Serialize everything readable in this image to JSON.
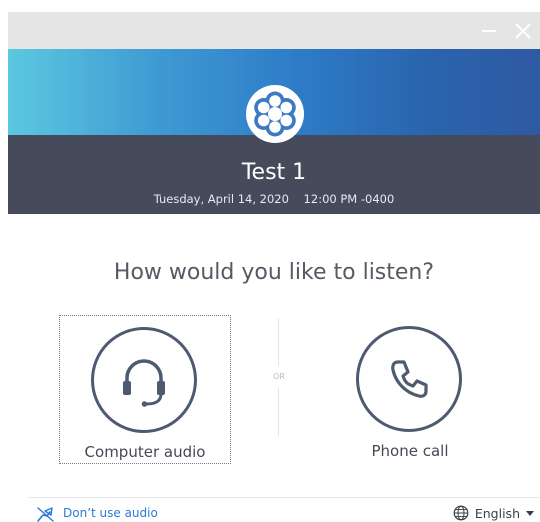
{
  "window": {
    "minimize_icon": "minimize-icon",
    "close_icon": "close-icon"
  },
  "header": {
    "logo_icon": "flower-logo-icon",
    "meeting_title": "Test 1",
    "meeting_datetime": "Tuesday, April 14, 2020    12:00 PM -0400",
    "gradient_colors": [
      "#5cc8df",
      "#2e5aa2"
    ],
    "band_color": "#454b5b"
  },
  "main": {
    "question": "How would you like to listen?",
    "options": [
      {
        "label": "Computer audio",
        "icon": "headset-icon",
        "selected": true
      },
      {
        "label": "Phone call",
        "icon": "phone-icon",
        "selected": false
      }
    ],
    "separator": "OR"
  },
  "footer": {
    "no_audio_label": "Don’t use audio",
    "no_audio_icon": "no-audio-icon",
    "language_label": "English",
    "language_icon": "globe-icon",
    "link_color": "#2c7bd4"
  }
}
